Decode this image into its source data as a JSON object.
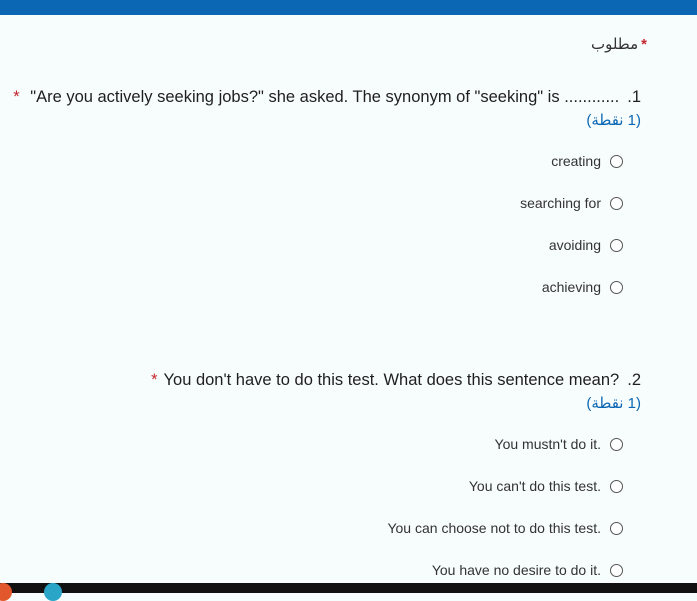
{
  "form": {
    "required_label": "مطلوب",
    "required_star": "*"
  },
  "questions": [
    {
      "number": "1.",
      "title": "............ Are you actively seeking jobs?\" she asked. The synonym of \"seeking\" is\" ",
      "required": "*",
      "points": "(1 نقطة)",
      "options": [
        "creating",
        "searching for",
        "avoiding",
        "achieving"
      ]
    },
    {
      "number": "2.",
      "title": "?You don't have to do this test. What does this sentence mean",
      "required": "*",
      "points": "(1 نقطة)",
      "options": [
        ".You mustn't do it",
        ".You can't do this test",
        ".You can choose not to do this test",
        ".You have no desire to do it"
      ]
    }
  ],
  "colors": {
    "header": "#0b67b3",
    "required": "#c4262e",
    "points": "#0b67b3"
  }
}
